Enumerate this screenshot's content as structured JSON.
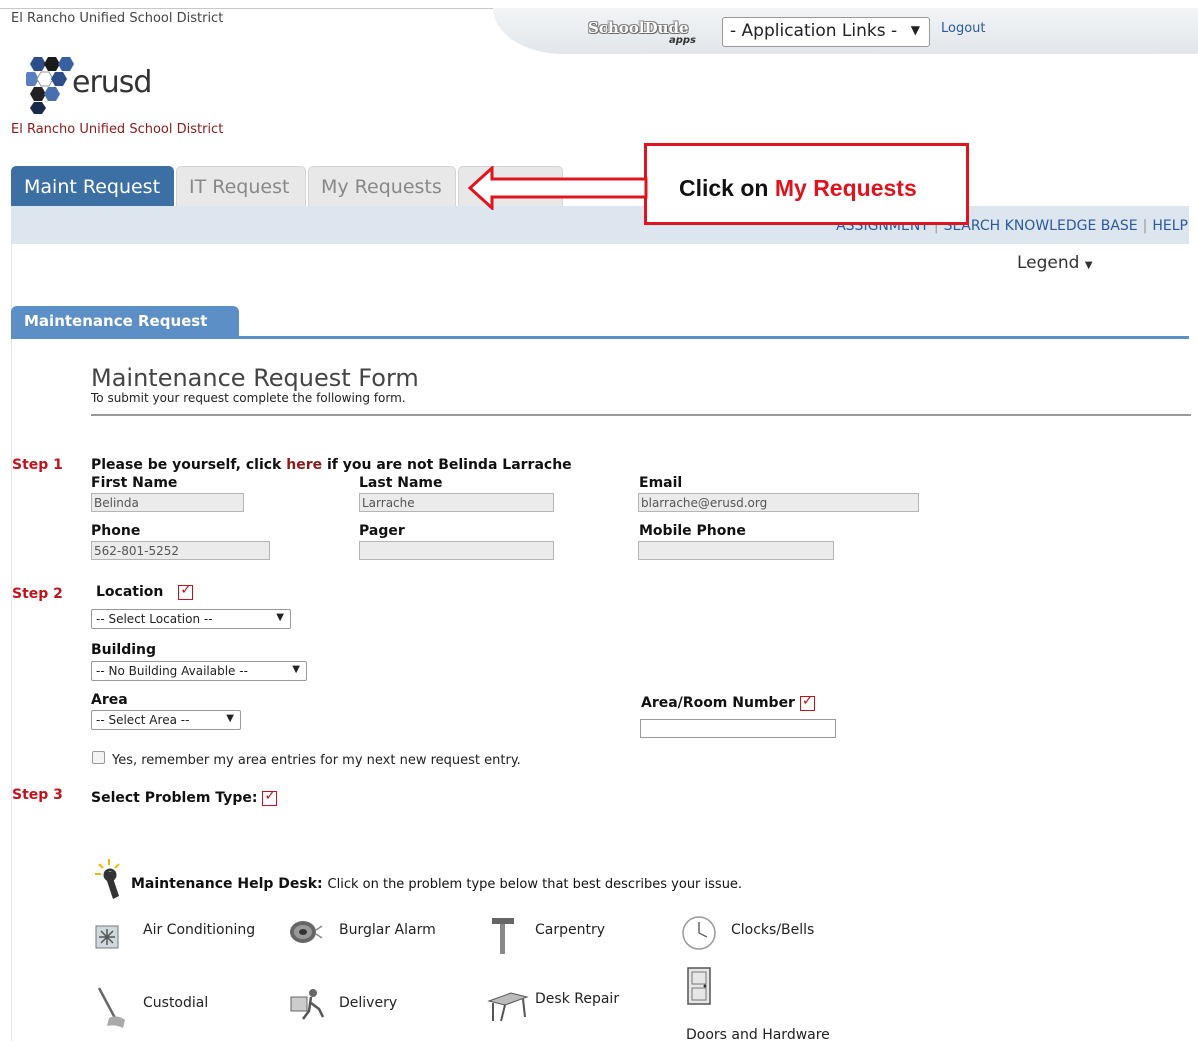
{
  "header": {
    "district_name": "El Rancho Unified School District",
    "logo_text": "erusd",
    "district_subtitle": "El Rancho Unified School District",
    "schooldude_logo": "SchoolDude",
    "schooldude_apps": "apps",
    "app_links": "- Application Links -",
    "logout": "Logout"
  },
  "tabs": [
    {
      "label": "Maint Request",
      "active": true
    },
    {
      "label": "IT Request",
      "active": false
    },
    {
      "label": "My Requests",
      "active": false
    }
  ],
  "top_links": {
    "assignment": "ASSIGNMENT",
    "search_kb": "SEARCH KNOWLEDGE BASE",
    "help": "HELP"
  },
  "legend": "Legend",
  "callout": {
    "prefix": "Click on ",
    "highlight": "My Requests"
  },
  "section_tab": "Maintenance Request",
  "form": {
    "title": "Maintenance Request Form",
    "subtitle": "To submit your request complete the following form."
  },
  "step1": {
    "step": "Step 1",
    "prompt_prefix": "Please be yourself, click ",
    "prompt_link": "here",
    "prompt_suffix": " if you are not Belinda Larrache",
    "first_name_label": "First Name",
    "first_name": "Belinda",
    "last_name_label": "Last Name",
    "last_name": "Larrache",
    "email_label": "Email",
    "email": "blarrache@erusd.org",
    "phone_label": "Phone",
    "phone": "562-801-5252",
    "pager_label": "Pager",
    "pager": "",
    "mobile_label": "Mobile Phone",
    "mobile": ""
  },
  "step2": {
    "step": "Step 2",
    "location_label": "Location",
    "location_value": "-- Select Location --",
    "building_label": "Building",
    "building_value": "-- No Building Available --",
    "area_label": "Area",
    "area_value": "-- Select Area --",
    "room_label": "Area/Room Number",
    "room_value": "",
    "remember": "Yes, remember my area entries for my next new request entry."
  },
  "step3": {
    "step": "Step 3",
    "label": "Select Problem Type:"
  },
  "helpdesk": {
    "title": "Maintenance Help Desk:",
    "description": "Click on the problem type below that best describes your issue.",
    "types": [
      "Air Conditioning",
      "Burglar Alarm",
      "Carpentry",
      "Clocks/Bells",
      "Custodial",
      "Delivery",
      "Desk Repair",
      "Doors and Hardware"
    ]
  },
  "icons": [
    "schooldude-logo",
    "erusd-logo",
    "arrow-left-icon",
    "caret-down-icon",
    "required-check-icon",
    "wrench-icon",
    "snowflake-icon",
    "alarm-icon",
    "hammer-icon",
    "clock-icon",
    "mop-icon",
    "dolly-icon",
    "desk-icon",
    "door-icon"
  ],
  "colors": {
    "tab_active": "#3c6fa4",
    "section_tab": "#5b8fc6",
    "step_red": "#c0141e",
    "callout_red": "#e0141e",
    "link_blue": "#2a5a9a"
  }
}
